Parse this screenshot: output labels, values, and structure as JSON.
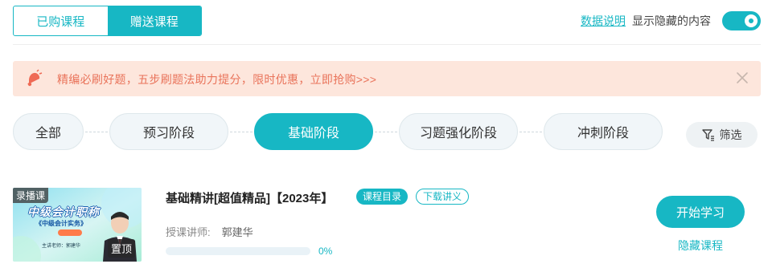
{
  "tabs": [
    {
      "label": "已购课程",
      "active": false
    },
    {
      "label": "赠送课程",
      "active": true
    }
  ],
  "header": {
    "data_link": "数据说明",
    "toggle_label": "显示隐藏的内容",
    "toggle_on": true
  },
  "banner": {
    "text": "精编必刷好题，五步刷题法助力提分，限时优惠，立即抢购>>>",
    "icon": "bell-icon",
    "close_icon": "close-icon"
  },
  "stages": [
    {
      "label": "全部",
      "active": false
    },
    {
      "label": "预习阶段",
      "active": false
    },
    {
      "label": "基础阶段",
      "active": true
    },
    {
      "label": "习题强化阶段",
      "active": false
    },
    {
      "label": "冲刺阶段",
      "active": false
    }
  ],
  "filter": {
    "label": "筛选",
    "icon": "filter-icon"
  },
  "course": {
    "thumb": {
      "rec_tag": "录播课",
      "pin_tag": "置顶",
      "title": "中级会计职称",
      "subtitle": "《中级会计实务》",
      "teacher_small": "主讲老师：郭建华"
    },
    "title": "基础精讲[超值精品]【2023年】",
    "catalog_tag": "课程目录",
    "download_tag": "下载讲义",
    "teacher_label": "授课讲师:",
    "teacher_name": "郭建华",
    "progress": 0,
    "progress_text": "0%",
    "start_button": "开始学习",
    "hide_link": "隐藏课程"
  },
  "colors": {
    "accent": "#17b7c4",
    "banner_bg": "#fde6dc",
    "banner_text": "#e9735a"
  }
}
